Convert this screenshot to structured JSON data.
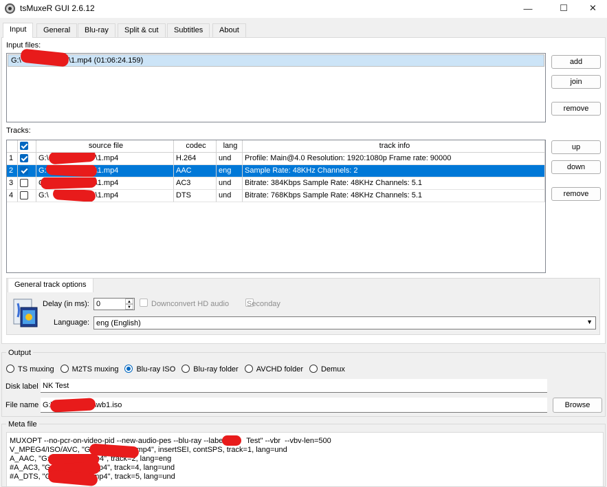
{
  "window": {
    "title": "tsMuxeR GUI 2.6.12",
    "minimize": "—",
    "maximize": "☐",
    "close": "✕"
  },
  "tabs": [
    {
      "label": "Input"
    },
    {
      "label": "General"
    },
    {
      "label": "Blu-ray"
    },
    {
      "label": "Split & cut"
    },
    {
      "label": "Subtitles"
    },
    {
      "label": "About"
    }
  ],
  "input": {
    "label": "Input files:",
    "file_prefix": "G:\\",
    "file_suffix": "\\1.mp4 (01:06:24.159)",
    "add": "add",
    "join": "join",
    "remove": "remove"
  },
  "tracks": {
    "label": "Tracks:",
    "headers": {
      "source": "source file",
      "codec": "codec",
      "lang": "lang",
      "info": "track info"
    },
    "rows": [
      {
        "num": "1",
        "src_prefix": "G:\\",
        "src_suffix": "\\1.mp4",
        "codec": "H.264",
        "lang": "und",
        "info": "Profile: Main@4.0  Resolution: 1920:1080p  Frame rate: 90000",
        "checked": true
      },
      {
        "num": "2",
        "src_prefix": "G:\\",
        "src_suffix": "\\1.mp4",
        "codec": "AAC",
        "lang": "eng",
        "info": "Sample Rate: 48KHz  Channels: 2",
        "checked": true
      },
      {
        "num": "3",
        "src_prefix": "G:\\",
        "src_suffix": "\\1.mp4",
        "codec": "AC3",
        "lang": "und",
        "info": "Bitrate: 384Kbps Sample Rate: 48KHz Channels: 5.1",
        "checked": false
      },
      {
        "num": "4",
        "src_prefix": "G:\\",
        "src_suffix": "\\1.mp4",
        "codec": "DTS",
        "lang": "und",
        "info": "Bitrate: 768Kbps  Sample Rate: 48KHz  Channels: 5.1",
        "checked": false
      }
    ],
    "up": "up",
    "down": "down",
    "remove": "remove"
  },
  "track_options": {
    "tab": "General track options",
    "delay_label": "Delay (in ms):",
    "delay_value": "0",
    "downconvert": "Downconvert HD audio",
    "secondary": "Seconday",
    "language_label": "Language:",
    "language_value": "eng (English)"
  },
  "output": {
    "label": "Output",
    "options": [
      "TS muxing",
      "M2TS muxing",
      "Blu-ray ISO",
      "Blu-ray folder",
      "AVCHD folder",
      "Demux"
    ],
    "selected_index": 2,
    "disk_label_label": "Disk label",
    "disk_label_value": "NK Test",
    "file_name_label": "File name",
    "file_name_prefix": "G:\\",
    "file_name_suffix": "\\wb1.iso",
    "browse": "Browse"
  },
  "meta": {
    "label": "Meta file",
    "lines": [
      "MUXOPT --no-pcr-on-video-pid --new-audio-pes --blu-ray --label=\"       Test\" --vbr  --vbv-len=500",
      "V_MPEG4/ISO/AVC, \"G:\\                \\1.mp4\", insertSEI, contSPS, track=1, lang=und",
      "A_AAC, \"G:\\              \\1.mp4\", track=2, lang=eng",
      "#A_AC3, \"G:\\              \\1.mp4\", track=4, lang=und",
      "#A_DTS, \"G:\\              \\1.mp4\", track=5, lang=und"
    ]
  },
  "colors": {
    "selection": "#0078d7",
    "accent": "#0067c0",
    "redaction": "#e81b1b"
  }
}
